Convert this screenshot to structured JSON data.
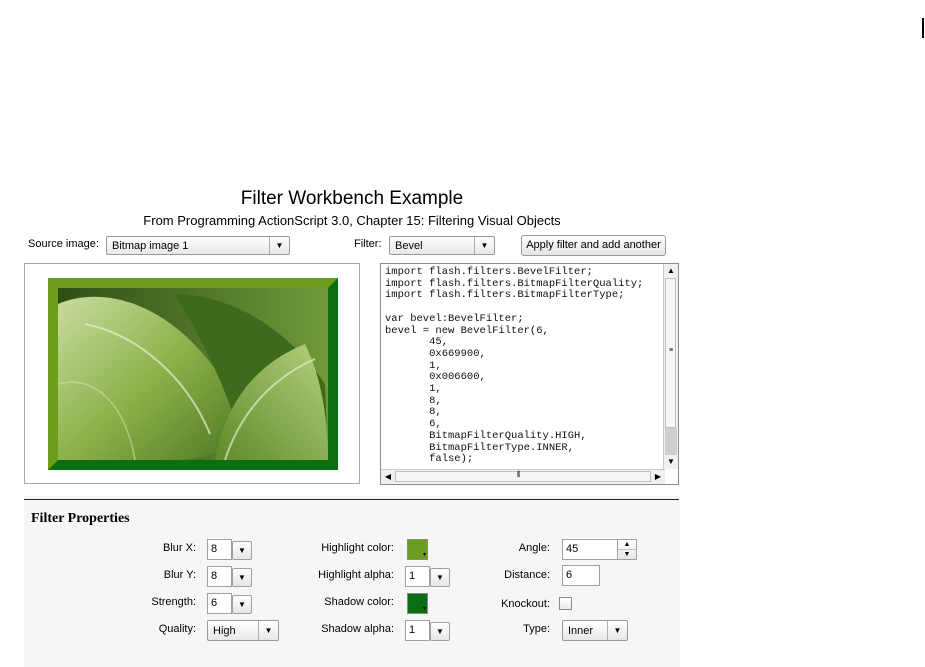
{
  "app": {
    "title": "Filter Workbench Example",
    "subtitle": "From Programming ActionScript 3.0, Chapter 15: Filtering Visual Objects"
  },
  "controls": {
    "source_label": "Source image:",
    "source_value": "Bitmap image 1",
    "filter_label": "Filter:",
    "filter_value": "Bevel",
    "apply_button": "Apply filter and add another"
  },
  "code_lines": [
    "import flash.filters.BevelFilter;",
    "import flash.filters.BitmapFilterQuality;",
    "import flash.filters.BitmapFilterType;",
    "",
    "var bevel:BevelFilter;",
    "bevel = new BevelFilter(6,",
    "       45,",
    "       0x669900,",
    "       1,",
    "       0x006600,",
    "       1,",
    "       8,",
    "       8,",
    "       6,",
    "       BitmapFilterQuality.HIGH,",
    "       BitmapFilterType.INNER,",
    "       false);"
  ],
  "properties": {
    "title": "Filter Properties",
    "blur_x": {
      "label": "Blur X:",
      "value": "8"
    },
    "blur_y": {
      "label": "Blur Y:",
      "value": "8"
    },
    "strength": {
      "label": "Strength:",
      "value": "6"
    },
    "quality": {
      "label": "Quality:",
      "value": "High"
    },
    "highlight_color": {
      "label": "Highlight color:",
      "color": "#6a9e1f"
    },
    "highlight_alpha": {
      "label": "Highlight alpha:",
      "value": "1"
    },
    "shadow_color": {
      "label": "Shadow color:",
      "color": "#0a6e14"
    },
    "shadow_alpha": {
      "label": "Shadow alpha:",
      "value": "1"
    },
    "angle": {
      "label": "Angle:",
      "value": "45"
    },
    "distance": {
      "label": "Distance:",
      "value": "6"
    },
    "knockout": {
      "label": "Knockout:",
      "checked": false
    },
    "type": {
      "label": "Type:",
      "value": "Inner"
    }
  },
  "icons": {
    "dropdown": "chevron-down-icon",
    "scroll_up": "arrow-up-icon",
    "scroll_down": "arrow-down-icon",
    "scroll_left": "arrow-left-icon",
    "scroll_right": "arrow-right-icon"
  },
  "colors": {
    "bevel_highlight": "#669900",
    "bevel_shadow": "#006600"
  }
}
